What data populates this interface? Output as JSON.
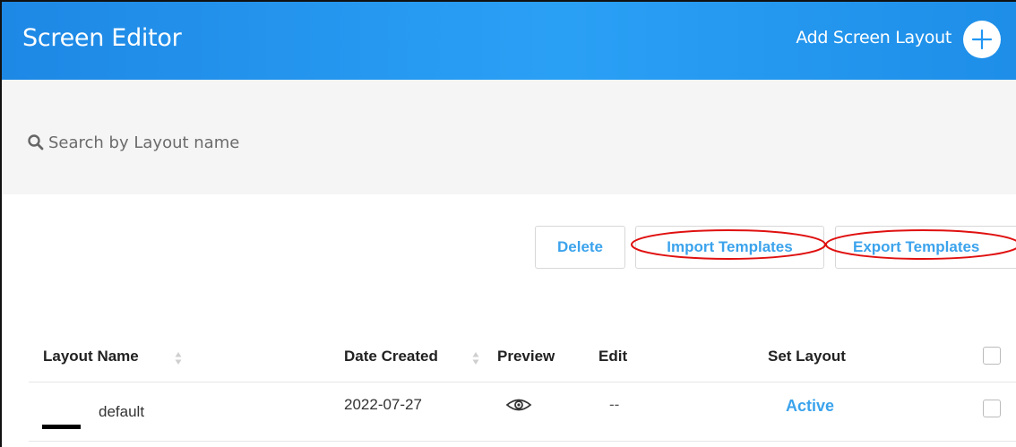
{
  "header": {
    "title": "Screen Editor",
    "add_label": "Add Screen Layout"
  },
  "search": {
    "placeholder": "Search by Layout name"
  },
  "actions": {
    "delete_label": "Delete",
    "import_label": "Import Templates",
    "export_label": "Export Templates"
  },
  "table": {
    "headers": {
      "layout_name": "Layout Name",
      "date_created": "Date Created",
      "preview": "Preview",
      "edit": "Edit",
      "set_layout": "Set Layout"
    },
    "rows": [
      {
        "name": "default",
        "date": "2022-07-27",
        "preview_icon": "eye-icon",
        "edit": "--",
        "set_layout": "Active",
        "checked": false
      }
    ]
  },
  "colors": {
    "header_blue": "#2196f3",
    "link_blue": "#3ba3ec",
    "annotation_red": "#e01010",
    "search_bg": "#f5f5f5"
  }
}
